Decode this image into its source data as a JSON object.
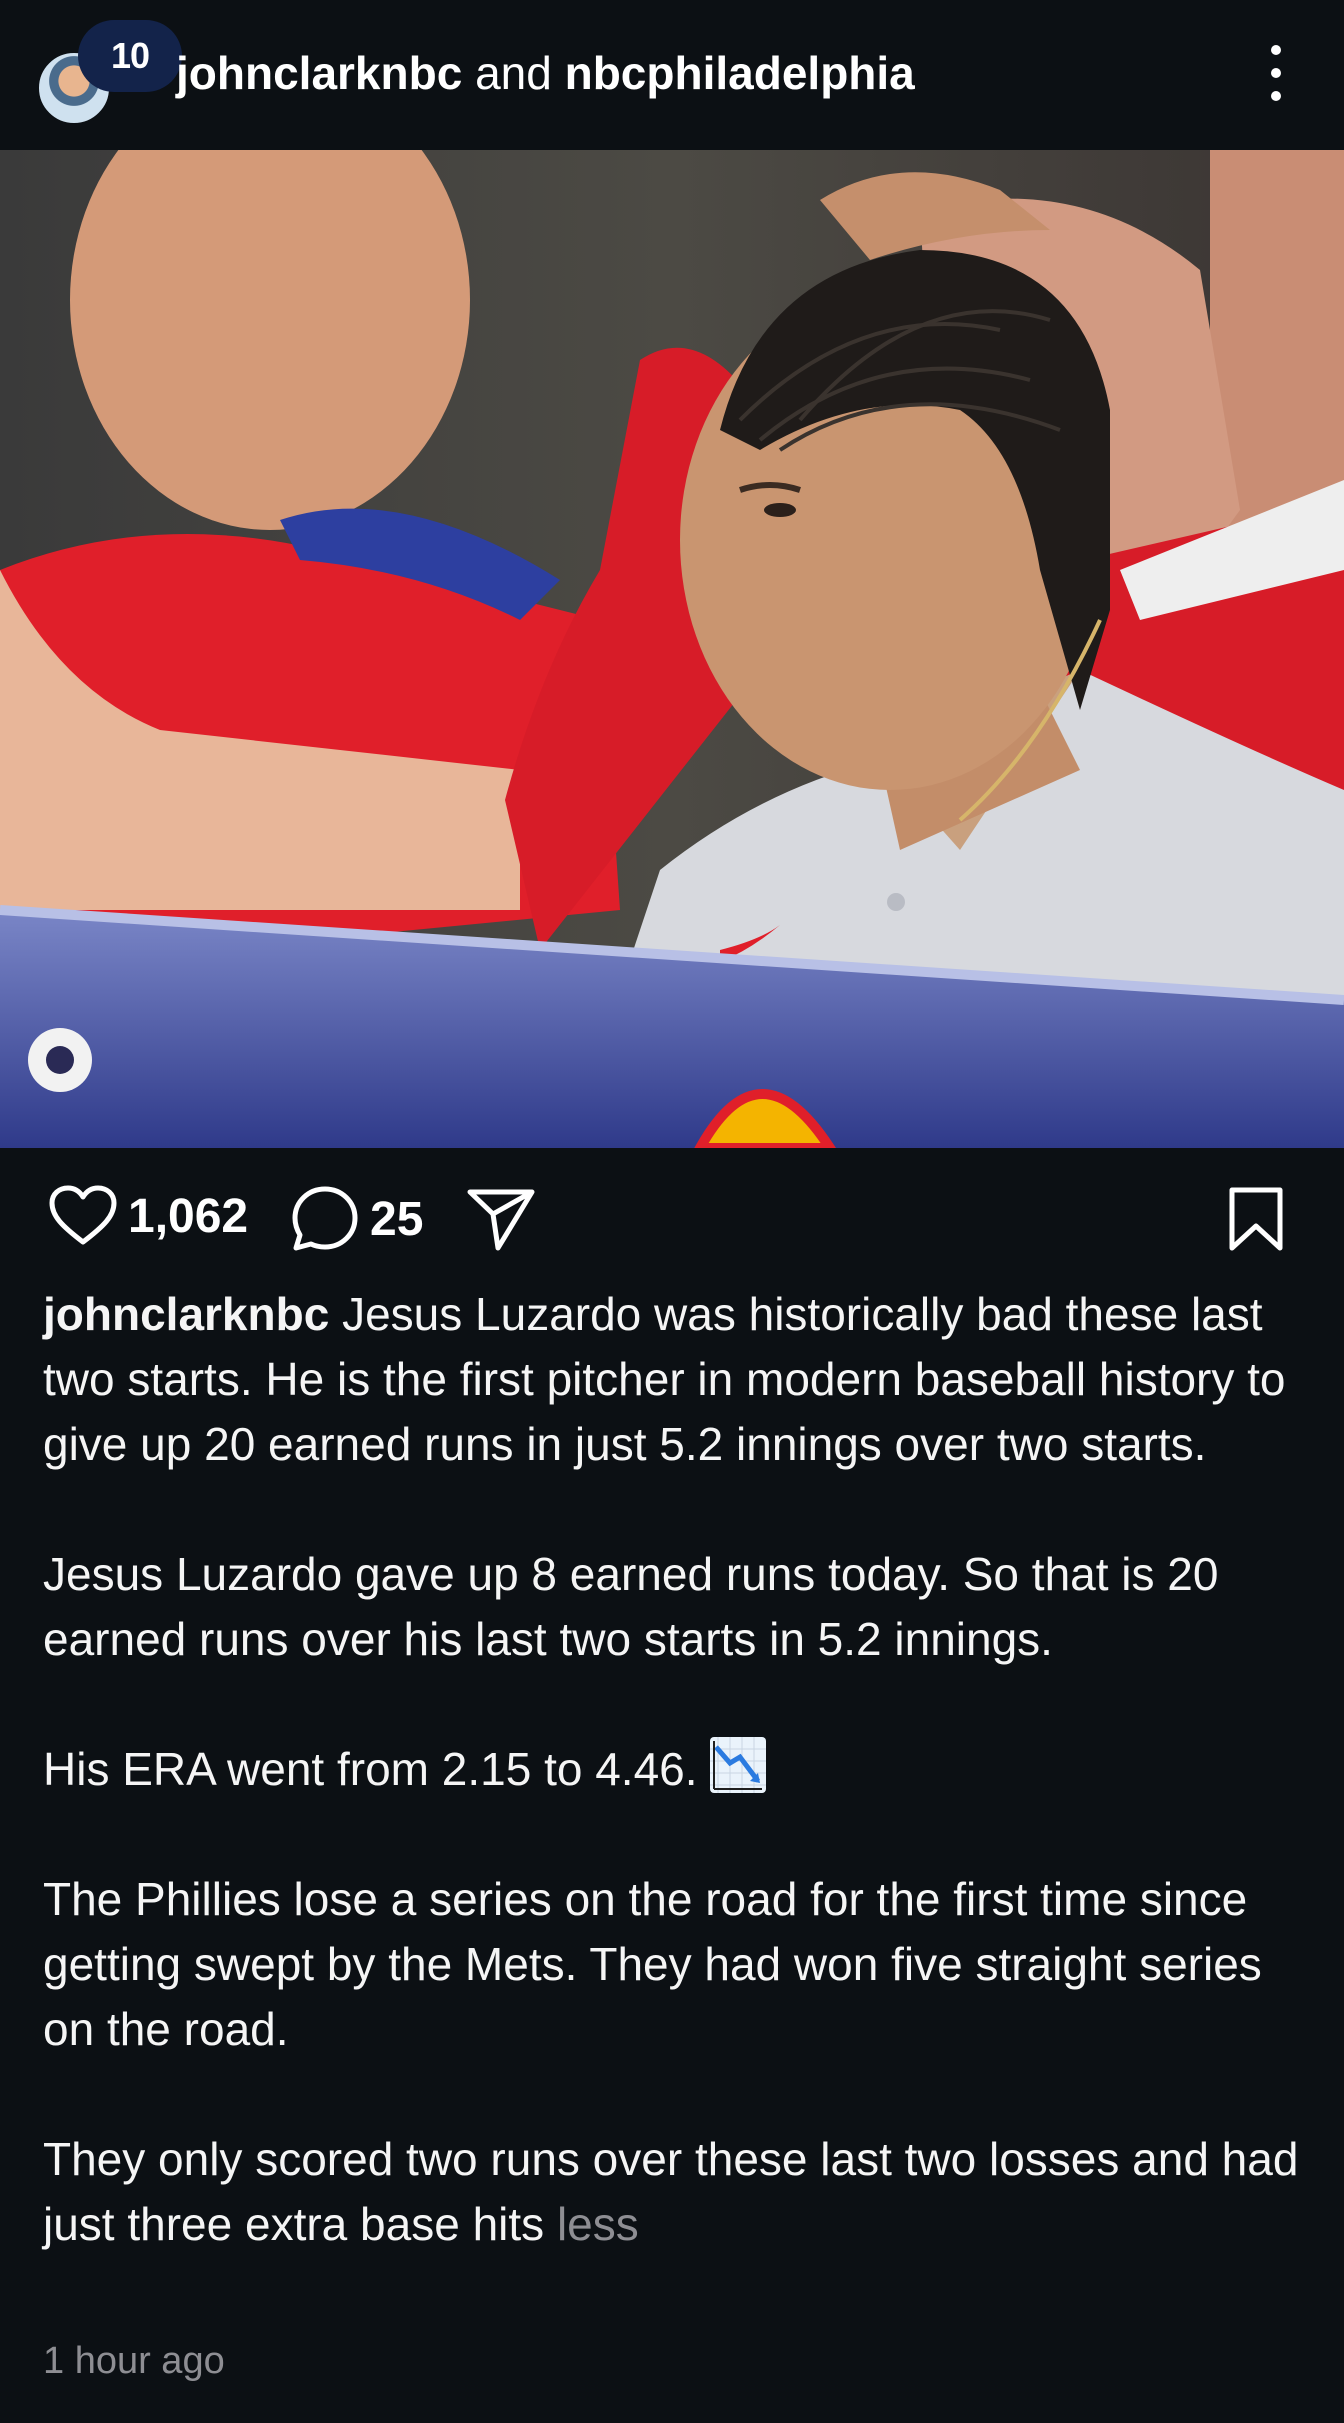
{
  "header": {
    "badge": "10",
    "user1": "johnclarknbc",
    "conj": " and ",
    "user2": "nbcphiladelphia"
  },
  "actions": {
    "likes": "1,062",
    "comments": "25"
  },
  "caption": {
    "username": "johnclarknbc",
    "p1": " Jesus Luzardo was historically bad these last two starts. He is the first pitcher in modern baseball history to give up 20 earned runs in just 5.2 innings over two starts.",
    "p2": "Jesus Luzardo gave up 8 earned runs today. So that is 20 earned runs over his last two starts in 5.2 innings.",
    "p3": "His ERA went from 2.15 to 4.46. ",
    "p4": "The Phillies lose a series on the road for the first time since getting swept by the Mets. They had won five straight series on the road.",
    "p5": "They only scored two runs over these last two losses and had just three extra base hits ",
    "less": "less"
  },
  "timestamp": "1 hour ago",
  "icons": {
    "like": "heart-icon",
    "comment": "comment-icon",
    "share": "send-icon",
    "save": "bookmark-icon",
    "more": "more-icon",
    "emoji": "chart-decreasing-emoji"
  }
}
